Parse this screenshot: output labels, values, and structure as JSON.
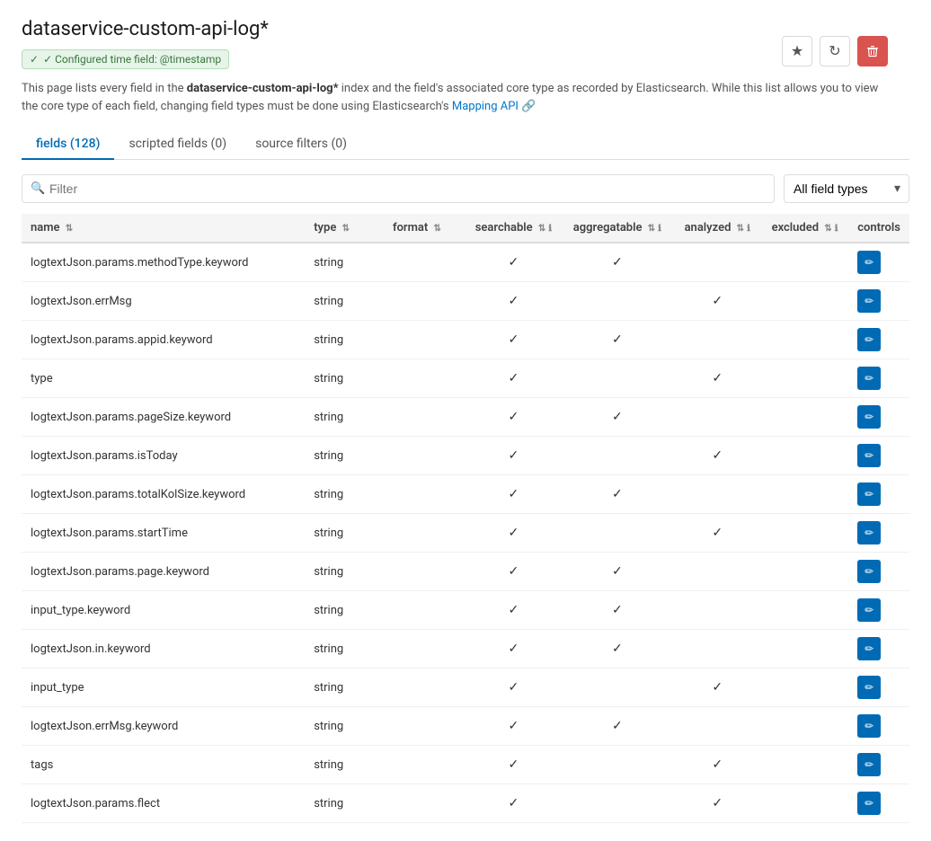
{
  "header": {
    "title": "dataservice-custom-api-log*",
    "time_field_label": "✓ Configured time field: @timestamp",
    "description_prefix": "This page lists every field in the ",
    "description_index": "dataservice-custom-api-log*",
    "description_suffix": " index and the field's associated core type as recorded by Elasticsearch. While this list allows you to view the core type of each field, changing field types must be done using Elasticsearch's ",
    "mapping_api_text": "Mapping API",
    "star_icon": "★",
    "refresh_icon": "↻",
    "delete_icon": "🗑"
  },
  "tabs": [
    {
      "label": "fields (128)",
      "active": true
    },
    {
      "label": "scripted fields (0)",
      "active": false
    },
    {
      "label": "source filters (0)",
      "active": false
    }
  ],
  "toolbar": {
    "filter_placeholder": "Filter",
    "field_type_label": "All field types"
  },
  "table": {
    "columns": [
      {
        "label": "name",
        "has_sort": true,
        "has_info": false
      },
      {
        "label": "type",
        "has_sort": true,
        "has_info": false
      },
      {
        "label": "format",
        "has_sort": true,
        "has_info": false
      },
      {
        "label": "searchable",
        "has_sort": true,
        "has_info": true
      },
      {
        "label": "aggregatable",
        "has_sort": true,
        "has_info": true
      },
      {
        "label": "analyzed",
        "has_sort": true,
        "has_info": true
      },
      {
        "label": "excluded",
        "has_sort": true,
        "has_info": true
      },
      {
        "label": "controls",
        "has_sort": false,
        "has_info": false
      }
    ],
    "rows": [
      {
        "name": "logtextJson.params.methodType.keyword",
        "type": "string",
        "format": "",
        "searchable": true,
        "aggregatable": true,
        "analyzed": false,
        "excluded": false
      },
      {
        "name": "logtextJson.errMsg",
        "type": "string",
        "format": "",
        "searchable": true,
        "aggregatable": false,
        "analyzed": true,
        "excluded": false
      },
      {
        "name": "logtextJson.params.appid.keyword",
        "type": "string",
        "format": "",
        "searchable": true,
        "aggregatable": true,
        "analyzed": false,
        "excluded": false
      },
      {
        "name": "type",
        "type": "string",
        "format": "",
        "searchable": true,
        "aggregatable": false,
        "analyzed": true,
        "excluded": false
      },
      {
        "name": "logtextJson.params.pageSize.keyword",
        "type": "string",
        "format": "",
        "searchable": true,
        "aggregatable": true,
        "analyzed": false,
        "excluded": false
      },
      {
        "name": "logtextJson.params.isToday",
        "type": "string",
        "format": "",
        "searchable": true,
        "aggregatable": false,
        "analyzed": true,
        "excluded": false
      },
      {
        "name": "logtextJson.params.totalKolSize.keyword",
        "type": "string",
        "format": "",
        "searchable": true,
        "aggregatable": true,
        "analyzed": false,
        "excluded": false
      },
      {
        "name": "logtextJson.params.startTime",
        "type": "string",
        "format": "",
        "searchable": true,
        "aggregatable": false,
        "analyzed": true,
        "excluded": false
      },
      {
        "name": "logtextJson.params.page.keyword",
        "type": "string",
        "format": "",
        "searchable": true,
        "aggregatable": true,
        "analyzed": false,
        "excluded": false
      },
      {
        "name": "input_type.keyword",
        "type": "string",
        "format": "",
        "searchable": true,
        "aggregatable": true,
        "analyzed": false,
        "excluded": false
      },
      {
        "name": "logtextJson.in.keyword",
        "type": "string",
        "format": "",
        "searchable": true,
        "aggregatable": true,
        "analyzed": false,
        "excluded": false
      },
      {
        "name": "input_type",
        "type": "string",
        "format": "",
        "searchable": true,
        "aggregatable": false,
        "analyzed": true,
        "excluded": false
      },
      {
        "name": "logtextJson.errMsg.keyword",
        "type": "string",
        "format": "",
        "searchable": true,
        "aggregatable": true,
        "analyzed": false,
        "excluded": false
      },
      {
        "name": "tags",
        "type": "string",
        "format": "",
        "searchable": true,
        "aggregatable": false,
        "analyzed": true,
        "excluded": false
      },
      {
        "name": "logtextJson.params.flect",
        "type": "string",
        "format": "",
        "searchable": true,
        "aggregatable": false,
        "analyzed": true,
        "excluded": false
      }
    ]
  }
}
